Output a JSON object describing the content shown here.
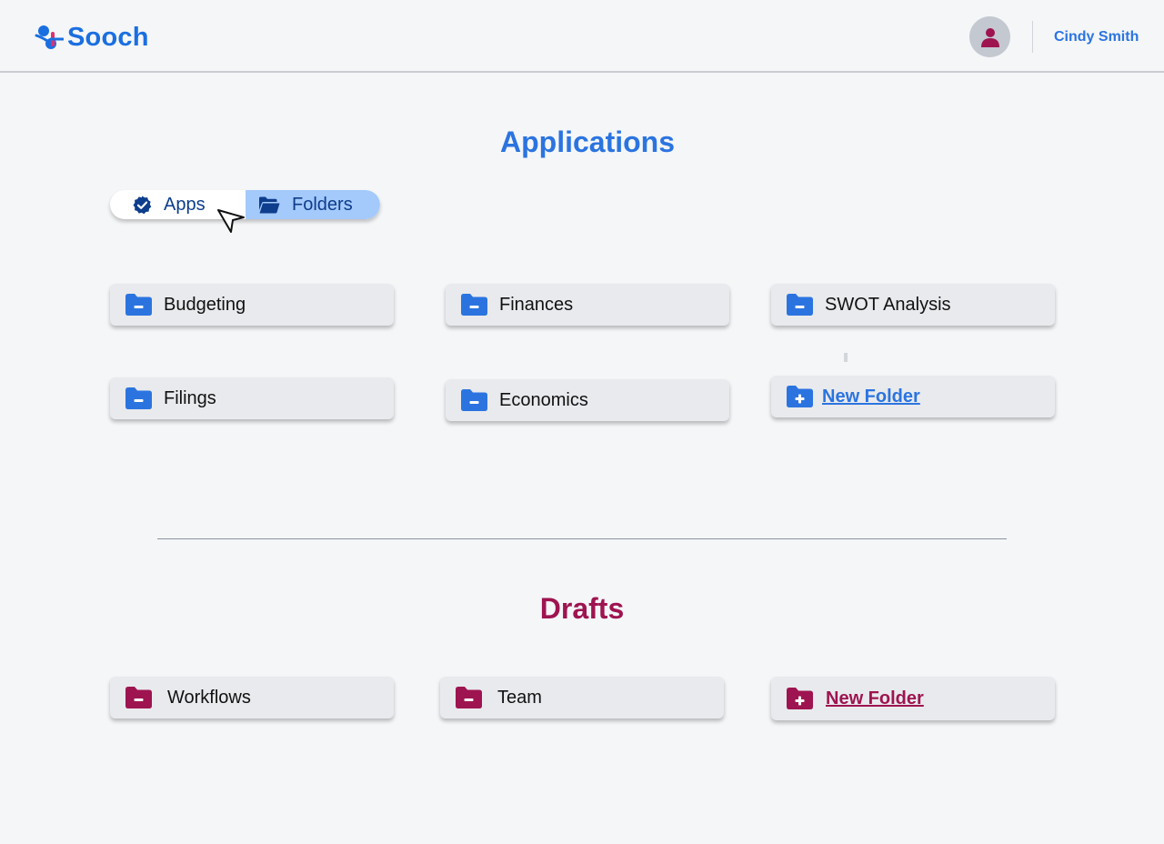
{
  "header": {
    "brand": "Sooch",
    "username": "Cindy Smith",
    "brand_color": "#1a6fe0",
    "avatar_icon": "user-icon"
  },
  "applications": {
    "title": "Applications",
    "toggle": {
      "apps_label": "Apps",
      "folders_label": "Folders",
      "selected": "Folders"
    },
    "folders": [
      {
        "label": "Budgeting",
        "icon": "folder-icon"
      },
      {
        "label": "Finances",
        "icon": "folder-icon"
      },
      {
        "label": "SWOT Analysis",
        "icon": "folder-icon"
      },
      {
        "label": "Filings",
        "icon": "folder-icon"
      },
      {
        "label": "Economics",
        "icon": "folder-icon"
      }
    ],
    "new_folder_label": "New Folder",
    "accent": "#2b74e0"
  },
  "drafts": {
    "title": "Drafts",
    "folders": [
      {
        "label": "Workflows",
        "icon": "folder-icon"
      },
      {
        "label": "Team",
        "icon": "folder-icon"
      }
    ],
    "new_folder_label": "New Folder",
    "accent": "#9e1450"
  }
}
